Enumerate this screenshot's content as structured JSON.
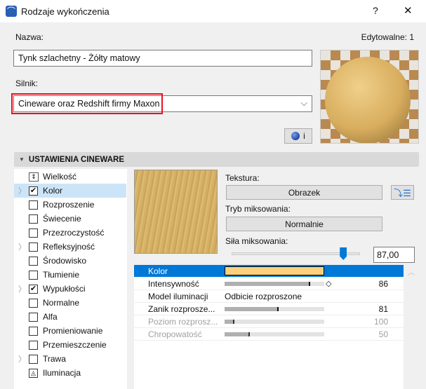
{
  "window": {
    "title": "Rodzaje wykończenia",
    "help": "?",
    "close": "✕"
  },
  "name_label": "Nazwa:",
  "editable": "Edytowalne: 1",
  "name_value": "Tynk szlachetny - Żółty matowy",
  "engine_label": "Silnik:",
  "engine_value": "Cineware oraz Redshift firmy Maxon",
  "info_button": "i",
  "section_title": "USTAWIENIA CINEWARE",
  "channels": [
    {
      "label": "Wielkość"
    },
    {
      "label": "Kolor",
      "checked": true,
      "expandable": true,
      "selected": true
    },
    {
      "label": "Rozproszenie"
    },
    {
      "label": "Świecenie"
    },
    {
      "label": "Przezroczystość"
    },
    {
      "label": "Refleksyjność",
      "expandable": true
    },
    {
      "label": "Środowisko"
    },
    {
      "label": "Tłumienie"
    },
    {
      "label": "Wypukłości",
      "checked": true,
      "expandable": true
    },
    {
      "label": "Normalne"
    },
    {
      "label": "Alfa"
    },
    {
      "label": "Promieniowanie"
    },
    {
      "label": "Przemieszczenie"
    },
    {
      "label": "Trawa",
      "expandable": true
    },
    {
      "label": "Iluminacja"
    }
  ],
  "texture_label": "Tekstura:",
  "texture_button": "Obrazek",
  "mix_mode_label": "Tryb miksowania:",
  "mix_mode_button": "Normalnie",
  "mix_strength_label": "Siła miksowania:",
  "mix_strength_value": "87,00",
  "mix_strength_fraction": 0.87,
  "properties": [
    {
      "name": "Kolor",
      "color": "#fdd07d"
    },
    {
      "name": "Intensywność",
      "value": "86",
      "fraction": 0.86
    },
    {
      "name": "Model iluminacji",
      "text": "Odbicie rozproszone"
    },
    {
      "name": "Zanik rozprosze...",
      "value": "81",
      "fraction": 0.54
    },
    {
      "name": "Poziom rozprosz...",
      "value": "100",
      "fraction": 0.1,
      "disabled": true
    },
    {
      "name": "Chropowatość",
      "value": "50",
      "fraction": 0.25,
      "disabled": true
    }
  ],
  "colors": {
    "accent": "#0078d7",
    "highlight": "#e81123",
    "selected_row": "#cce4f7"
  }
}
